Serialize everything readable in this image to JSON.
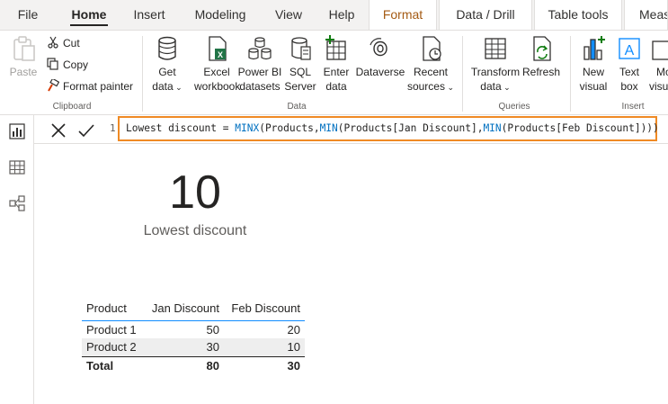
{
  "tabs": {
    "file": "File",
    "home": "Home",
    "insert": "Insert",
    "modeling": "Modeling",
    "view": "View",
    "help": "Help",
    "format": "Format",
    "data_drill": "Data / Drill",
    "table_tools": "Table tools",
    "measure": "Meas"
  },
  "ribbon": {
    "clipboard": {
      "paste": "Paste",
      "cut": "Cut",
      "copy": "Copy",
      "format_painter": "Format painter",
      "label": "Clipboard"
    },
    "data": {
      "get_data_1": "Get",
      "get_data_2": "data",
      "excel_1": "Excel",
      "excel_2": "workbook",
      "pbi_1": "Power BI",
      "pbi_2": "datasets",
      "sql_1": "SQL",
      "sql_2": "Server",
      "enter_1": "Enter",
      "enter_2": "data",
      "dataverse": "Dataverse",
      "recent_1": "Recent",
      "recent_2": "sources",
      "label": "Data"
    },
    "queries": {
      "transform_1": "Transform",
      "transform_2": "data",
      "refresh": "Refresh",
      "label": "Queries"
    },
    "insert": {
      "new_visual_1": "New",
      "new_visual_2": "visual",
      "text_box_1": "Text",
      "text_box_2": "box",
      "more_1": "Mo",
      "more_2": "visua",
      "label": "Insert"
    }
  },
  "formula_bar": {
    "line_number": "1",
    "measure_name": "Lowest discount = ",
    "fn1": "MINX",
    "part1": "(Products,",
    "fn2": "MIN",
    "part2": "(Products[Jan Discount],",
    "fn3": "MIN",
    "part3": "(Products[Feb Discount])))"
  },
  "card": {
    "value": "10",
    "label": "Lowest discount"
  },
  "table": {
    "headers": [
      "Product",
      "Jan Discount",
      "Feb Discount"
    ],
    "rows": [
      [
        "Product 1",
        "50",
        "20"
      ],
      [
        "Product 2",
        "30",
        "10"
      ]
    ],
    "total": [
      "Total",
      "80",
      "30"
    ]
  },
  "colors": {
    "accent_blue": "#118dff",
    "highlight_orange": "#f08a24",
    "format_tab": "#a45a13",
    "dax_keyword": "#0070c0"
  }
}
